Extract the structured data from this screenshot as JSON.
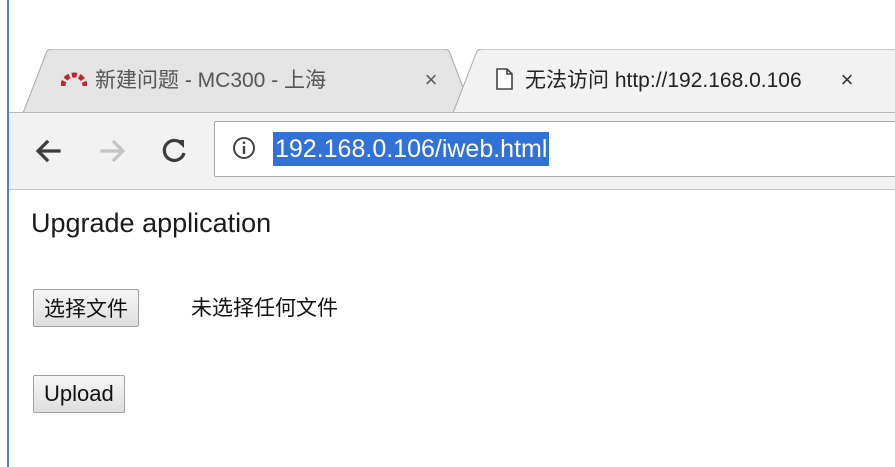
{
  "browser": {
    "tabs": [
      {
        "favicon": "redmine-logo-icon",
        "title": "新建问题 - MC300 - 上海",
        "active": false,
        "close_label": "×"
      },
      {
        "favicon": "page-icon",
        "title": "无法访问 http://192.168.0.106",
        "active": true,
        "close_label": "×"
      }
    ],
    "toolbar": {
      "back_icon": "back-arrow-icon",
      "forward_icon": "forward-arrow-icon",
      "reload_icon": "reload-icon",
      "info_icon": "info-icon",
      "url": "192.168.0.106/iweb.html"
    }
  },
  "page": {
    "heading": "Upgrade application",
    "file_input": {
      "button_label": "选择文件",
      "status": "未选择任何文件"
    },
    "upload_label": "Upload"
  },
  "colors": {
    "url_selection": "#3271d6",
    "toolbar_bg": "#f2f2f2",
    "inactive_tab_bg": "#e4e4e4",
    "window_edge": "#4a7fd6",
    "favicon_red": "#c3262e"
  }
}
